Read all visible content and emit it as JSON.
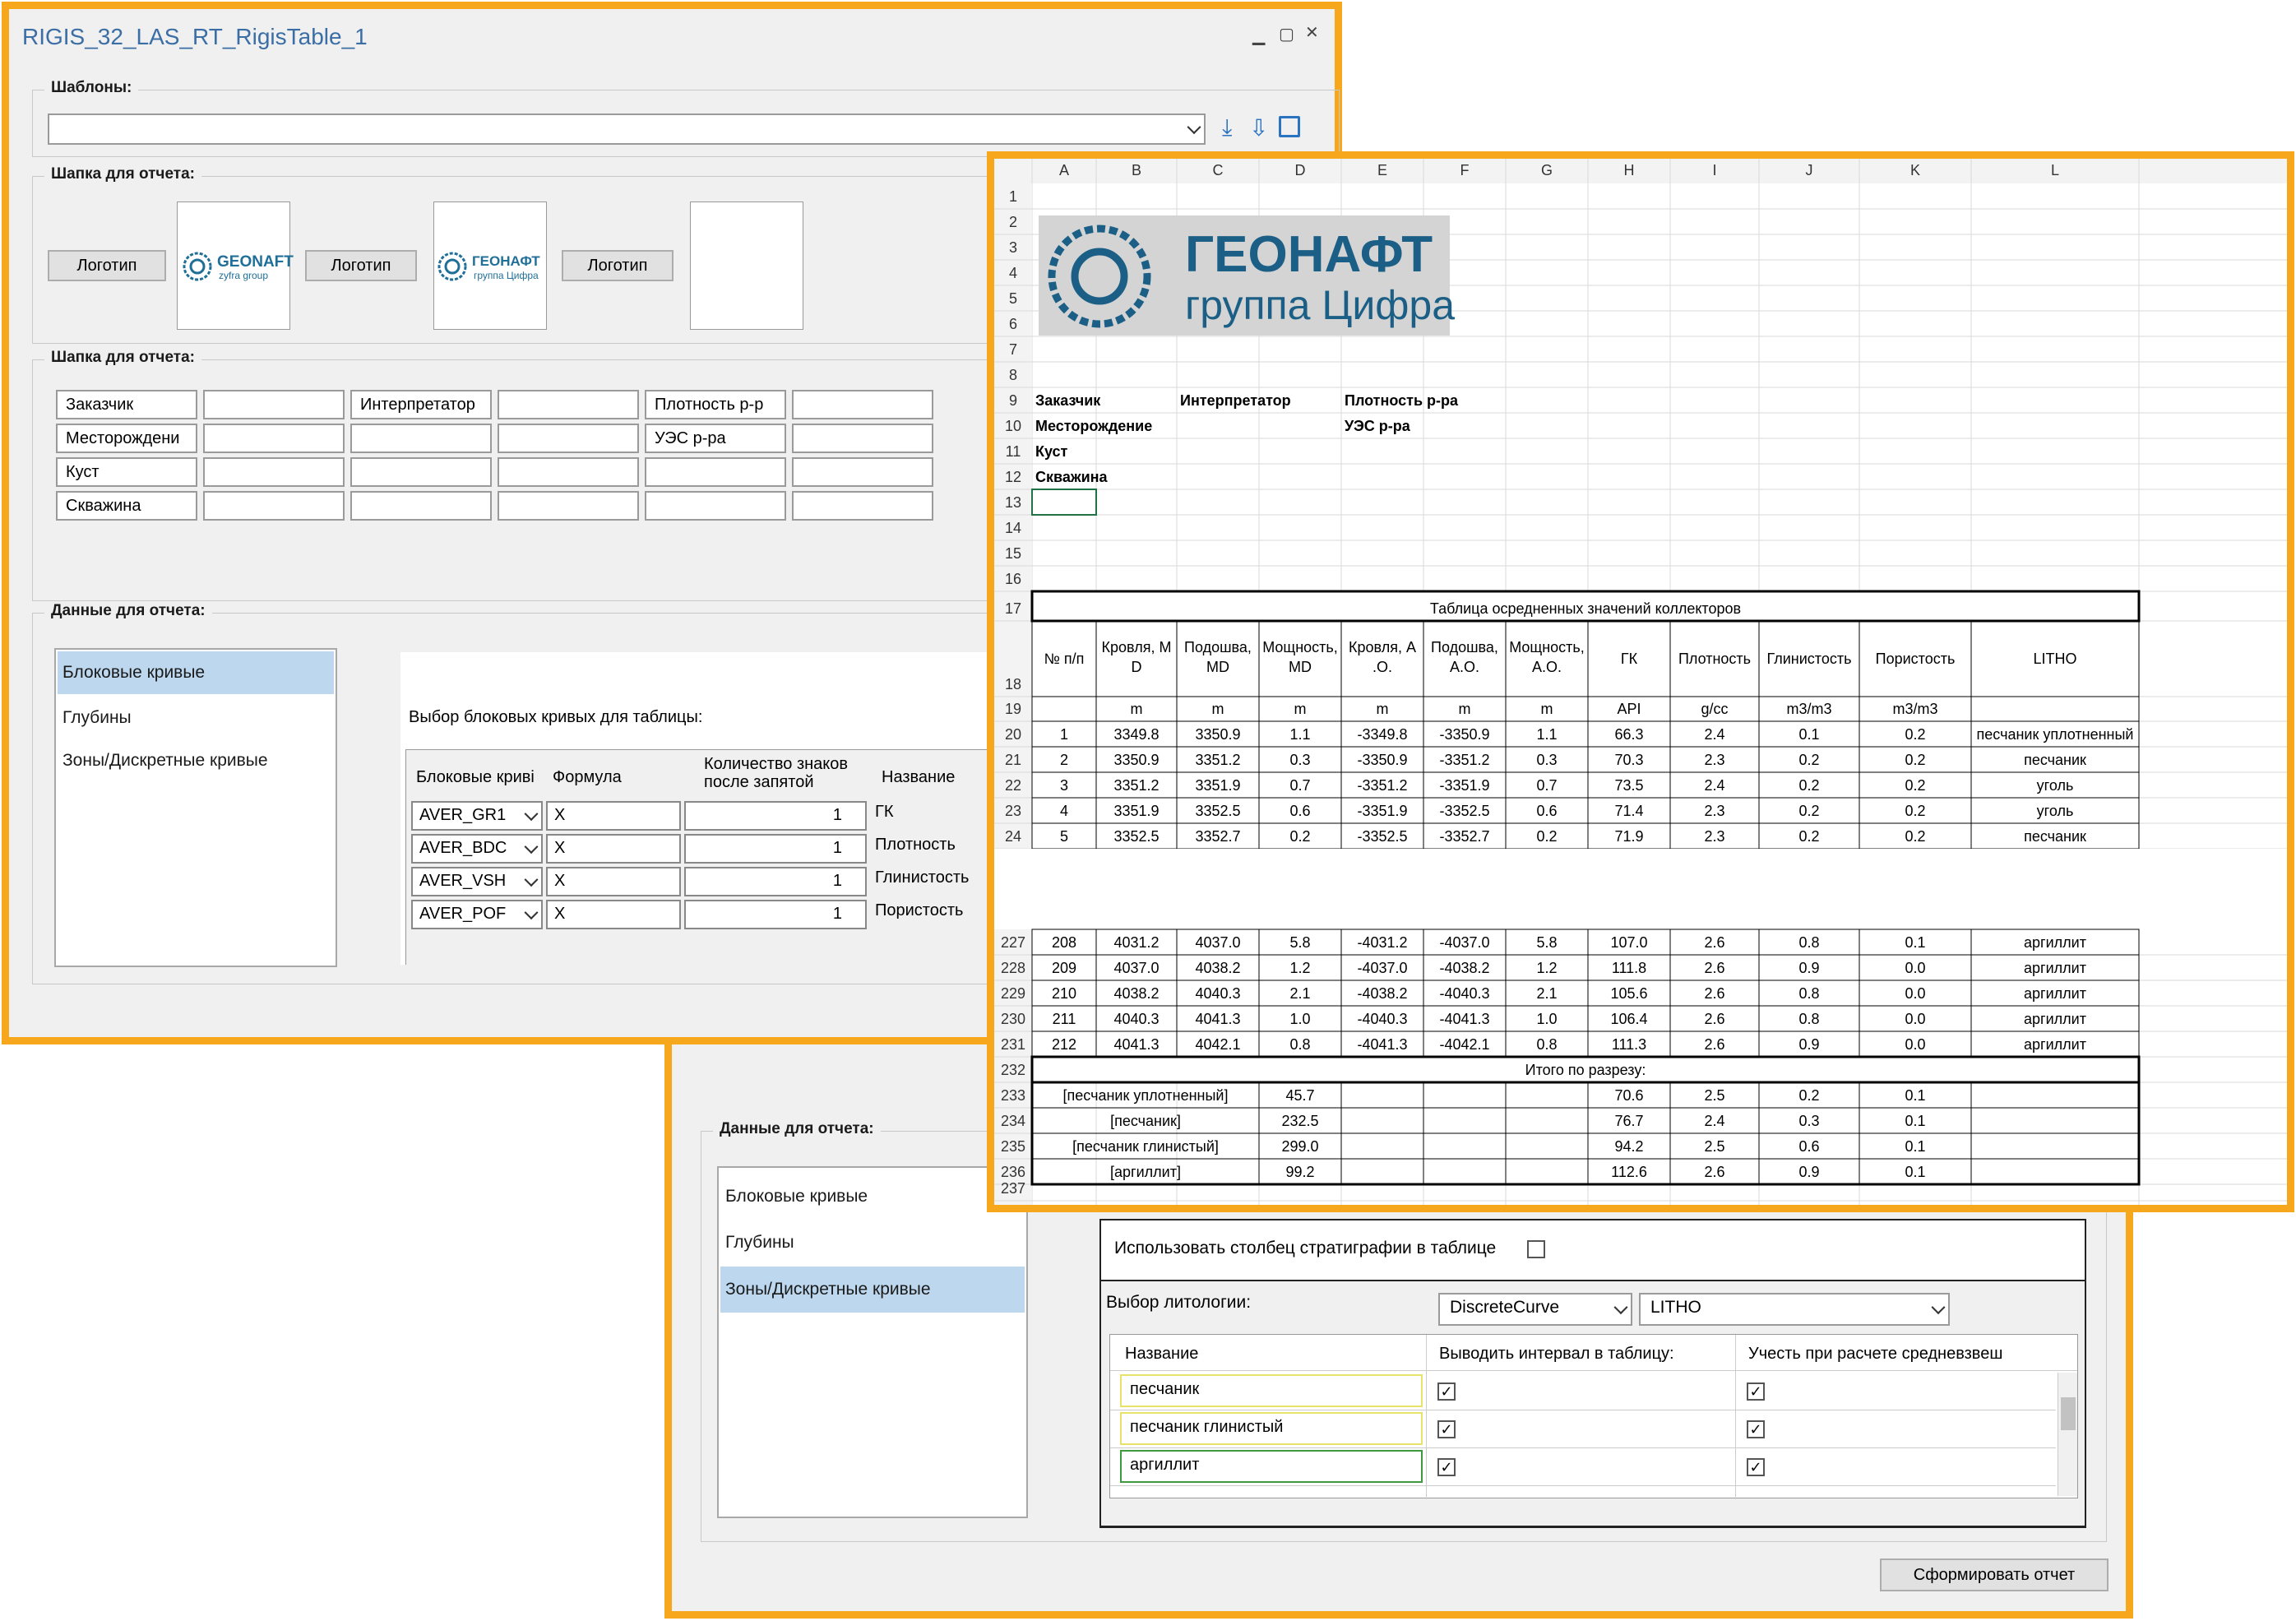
{
  "win1": {
    "title": "RIGIS_32_LAS_RT_RigisTable_1",
    "templates_label": "Шаблоны:",
    "header1_label": "Шапка для отчета:",
    "logo_btn": "Логотип",
    "logo1_text": "GEONAFT",
    "logo1_sub": "zyfra group",
    "logo2_text": "ГЕОНАФТ",
    "logo2_sub": "группа Цифра",
    "header2_label": "Шапка для отчета:",
    "fields": [
      "Заказчик",
      "Интерпретатор",
      "Плотность р-р",
      "Месторождени",
      "УЭС р-ра",
      "Куст",
      "Скважина"
    ],
    "data_label": "Данные для отчета:",
    "list": [
      "Блоковые кривые",
      "Глубины",
      "Зоны/Дискретные кривые"
    ],
    "choose_label": "Выбор блоковых кривых для таблицы:",
    "grid_headers": [
      "Блоковые криві",
      "Формула",
      "Количество знаков после запятой",
      "Название"
    ],
    "grid_rows": [
      {
        "curve": "AVER_GR1",
        "formula": "X",
        "digits": "1",
        "name": "ГК"
      },
      {
        "curve": "AVER_BDC",
        "formula": "X",
        "digits": "1",
        "name": "Плотность"
      },
      {
        "curve": "AVER_VSH",
        "formula": "X",
        "digits": "1",
        "name": "Глинистость"
      },
      {
        "curve": "AVER_POF",
        "formula": "X",
        "digits": "1",
        "name": "Пористость"
      }
    ]
  },
  "win2": {
    "data_label": "Данные для отчета:",
    "list": [
      "Блоковые кривые",
      "Глубины",
      "Зоны/Дискретные кривые"
    ],
    "strat_label": "Использовать столбец стратиграфии в таблице",
    "litho_label": "Выбор литологии:",
    "dd1": "DiscreteCurve",
    "dd2": "LITHO",
    "lith_headers": [
      "Название",
      "Выводить интервал в таблицу:",
      "Учесть при расчете средневзвеш"
    ],
    "lith_rows": [
      "песчаник",
      "песчаник глинистый",
      "аргиллит"
    ],
    "generate_btn": "Сформировать отчет"
  },
  "sheet": {
    "columns": [
      "A",
      "B",
      "C",
      "D",
      "E",
      "F",
      "G",
      "H",
      "I",
      "J",
      "K",
      "L"
    ],
    "logo_title": "ГЕОНАФТ",
    "logo_sub": "группа Цифра",
    "info": {
      "zakazchik": "Заказчик",
      "interp": "Интерпретатор",
      "plotn": "Плотность р-ра",
      "mestor": "Месторождение",
      "ues": "УЭС р-ра",
      "kust": "Куст",
      "skv": "Скважина"
    },
    "table_title": "Таблица осредненных значений коллекторов",
    "headers": [
      "№ п/п",
      "Кровля, MD",
      "Подошва, MD",
      "Мощность, MD",
      "Кровля, А.О.",
      "Подошва, А.О.",
      "Мощность, А.О.",
      "ГК",
      "Плотность",
      "Глинистость",
      "Пористость",
      "LITHO"
    ],
    "units": [
      "",
      "m",
      "m",
      "m",
      "m",
      "m",
      "m",
      "API",
      "g/cc",
      "m3/m3",
      "m3/m3",
      ""
    ],
    "rows_top": [
      {
        "r": "20",
        "v": [
          "1",
          "3349.8",
          "3350.9",
          "1.1",
          "-3349.8",
          "-3350.9",
          "1.1",
          "66.3",
          "2.4",
          "0.1",
          "0.2",
          "песчаник уплотненный"
        ]
      },
      {
        "r": "21",
        "v": [
          "2",
          "3350.9",
          "3351.2",
          "0.3",
          "-3350.9",
          "-3351.2",
          "0.3",
          "70.3",
          "2.3",
          "0.2",
          "0.2",
          "песчаник"
        ]
      },
      {
        "r": "22",
        "v": [
          "3",
          "3351.2",
          "3351.9",
          "0.7",
          "-3351.2",
          "-3351.9",
          "0.7",
          "73.5",
          "2.4",
          "0.2",
          "0.2",
          "уголь"
        ]
      },
      {
        "r": "23",
        "v": [
          "4",
          "3351.9",
          "3352.5",
          "0.6",
          "-3351.9",
          "-3352.5",
          "0.6",
          "71.4",
          "2.3",
          "0.2",
          "0.2",
          "уголь"
        ]
      },
      {
        "r": "24",
        "v": [
          "5",
          "3352.5",
          "3352.7",
          "0.2",
          "-3352.5",
          "-3352.7",
          "0.2",
          "71.9",
          "2.3",
          "0.2",
          "0.2",
          "песчаник"
        ]
      }
    ],
    "rows_bottom": [
      {
        "r": "227",
        "v": [
          "208",
          "4031.2",
          "4037.0",
          "5.8",
          "-4031.2",
          "-4037.0",
          "5.8",
          "107.0",
          "2.6",
          "0.8",
          "0.1",
          "аргиллит"
        ]
      },
      {
        "r": "228",
        "v": [
          "209",
          "4037.0",
          "4038.2",
          "1.2",
          "-4037.0",
          "-4038.2",
          "1.2",
          "111.8",
          "2.6",
          "0.9",
          "0.0",
          "аргиллит"
        ]
      },
      {
        "r": "229",
        "v": [
          "210",
          "4038.2",
          "4040.3",
          "2.1",
          "-4038.2",
          "-4040.3",
          "2.1",
          "105.6",
          "2.6",
          "0.8",
          "0.0",
          "аргиллит"
        ]
      },
      {
        "r": "230",
        "v": [
          "211",
          "4040.3",
          "4041.3",
          "1.0",
          "-4040.3",
          "-4041.3",
          "1.0",
          "106.4",
          "2.6",
          "0.8",
          "0.0",
          "аргиллит"
        ]
      },
      {
        "r": "231",
        "v": [
          "212",
          "4041.3",
          "4042.1",
          "0.8",
          "-4041.3",
          "-4042.1",
          "0.8",
          "111.3",
          "2.6",
          "0.9",
          "0.0",
          "аргиллит"
        ]
      }
    ],
    "total_label": "Итого по разрезу:",
    "totals": [
      {
        "r": "233",
        "name": "[песчаник уплотненный]",
        "thick": "45.7",
        "gk": "70.6",
        "pl": "2.5",
        "gl": "0.2",
        "por": "0.1"
      },
      {
        "r": "234",
        "name": "[песчаник]",
        "thick": "232.5",
        "gk": "76.7",
        "pl": "2.4",
        "gl": "0.3",
        "por": "0.1"
      },
      {
        "r": "235",
        "name": "[песчаник глинистый]",
        "thick": "299.0",
        "gk": "94.2",
        "pl": "2.5",
        "gl": "0.6",
        "por": "0.1"
      },
      {
        "r": "236",
        "name": "[аргиллит]",
        "thick": "99.2",
        "gk": "112.6",
        "pl": "2.6",
        "gl": "0.9",
        "por": "0.1"
      }
    ]
  }
}
